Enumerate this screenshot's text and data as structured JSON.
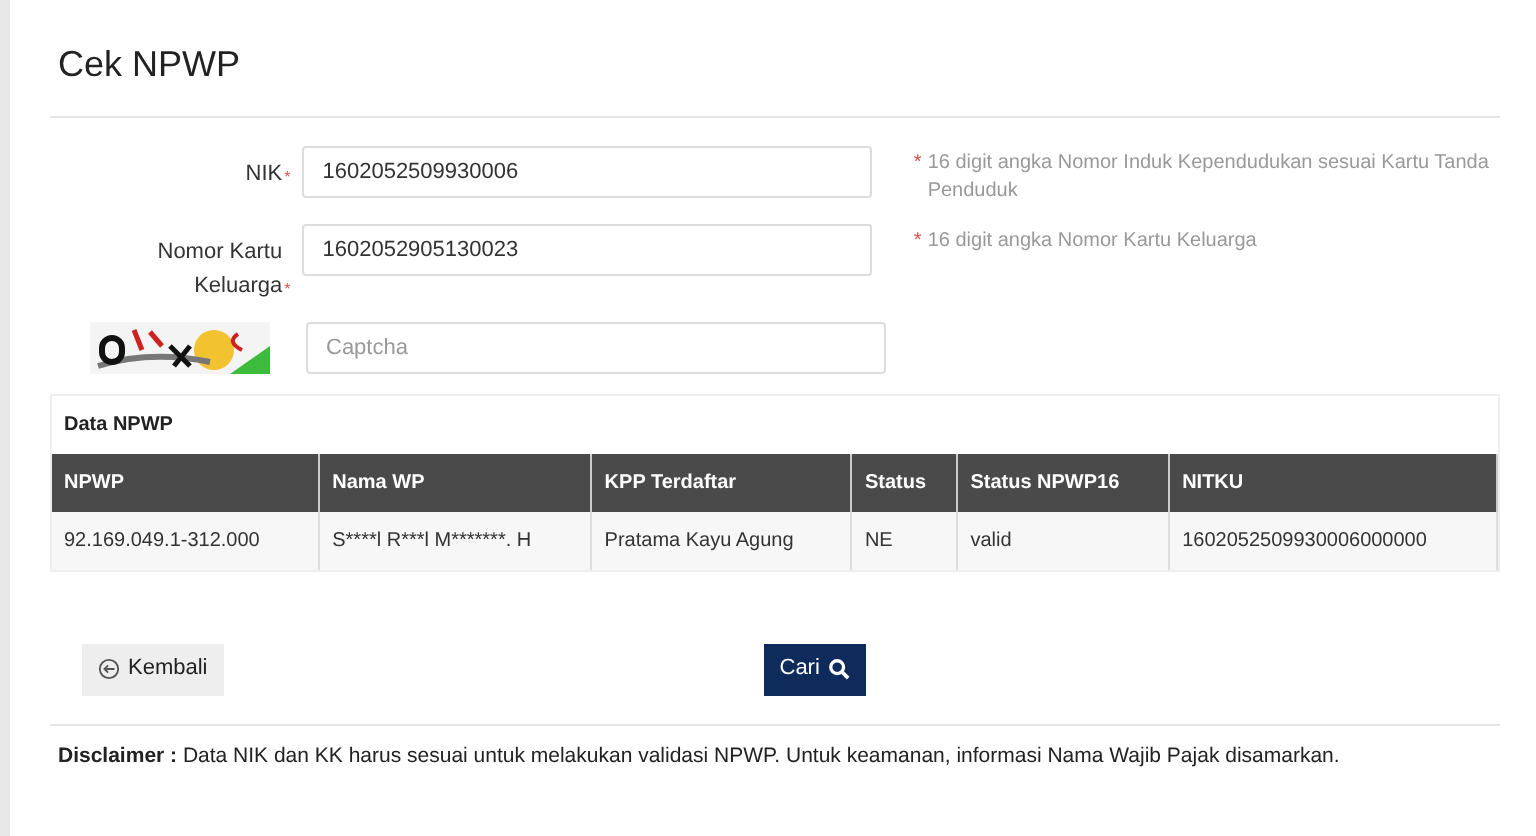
{
  "title": "Cek NPWP",
  "required_mark": "*",
  "fields": [
    {
      "label": "NIK",
      "required": true,
      "value": "1602052509930006",
      "hint": "16 digit angka Nomor Induk Kependudukan sesuai Kartu Tanda Penduduk"
    },
    {
      "label": "Nomor Kartu Keluarga",
      "required": true,
      "value": "1602052905130023",
      "hint": "16 digit angka Nomor Kartu Keluarga"
    }
  ],
  "captcha": {
    "kind": "picture",
    "placeholder": "Captcha"
  },
  "result": {
    "title": "Data NPWP",
    "columns": [
      "NPWP",
      "Nama WP",
      "KPP Terdaftar",
      "Status",
      "Status NPWP16",
      "NITKU"
    ],
    "rows": [
      [
        "92.169.049.1-312.000",
        "S****l R***l M*******. H",
        "Pratama Kayu Agung",
        "NE",
        "valid",
        "1602052509930006000000"
      ]
    ]
  },
  "buttons": {
    "back": "Kembali",
    "search": "Cari"
  },
  "disclaimer": "**Disclaimer :** Data NIK dan KK harus sesuai untuk melakukan validasi NPWP. Untuk keamanan, informasi Nama Wajib Pajak disamarkan."
}
